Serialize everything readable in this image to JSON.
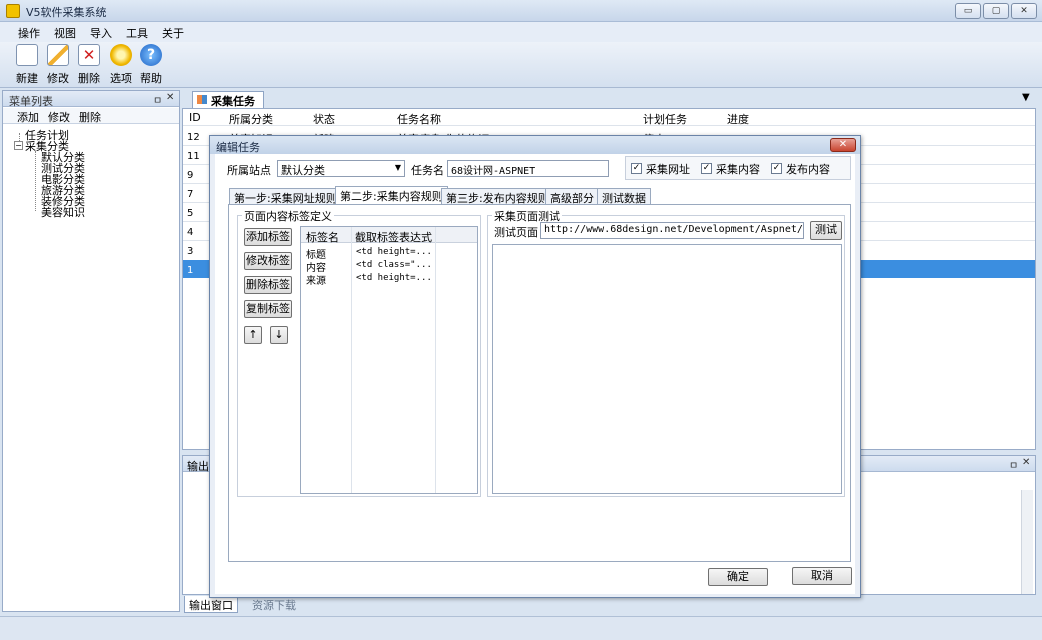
{
  "window": {
    "title": "V5软件采集系统",
    "min": "▭",
    "max": "▢",
    "close": "✕"
  },
  "menu": [
    "操作",
    "视图",
    "导入",
    "工具",
    "关于"
  ],
  "toolbar": [
    {
      "label": "新建",
      "icon": "new-document-icon"
    },
    {
      "label": "修改",
      "icon": "edit-pencil-icon"
    },
    {
      "label": "删除",
      "icon": "delete-x-icon"
    },
    {
      "label": "选项",
      "icon": "gear-options-icon"
    },
    {
      "label": "帮助",
      "icon": "help-question-icon"
    }
  ],
  "left_panel": {
    "title": "菜单列表",
    "pin": "ㅁ",
    "close": "✕",
    "actions": [
      "添加",
      "修改",
      "删除"
    ],
    "tree": {
      "root1": "任务计划",
      "root2": "采集分类",
      "children": [
        "默认分类",
        "测试分类",
        "电影分类",
        "旅游分类",
        "装修分类",
        "美容知识"
      ]
    }
  },
  "doc_tab": "采集任务",
  "task_table": {
    "columns": [
      "ID",
      "所属分类",
      "状态",
      "任务名称",
      "计划任务",
      "进度"
    ],
    "ids": [
      "12",
      "11",
      "9",
      "7",
      "5",
      "4",
      "3",
      "1"
    ],
    "partial_row": {
      "category": "美容知识",
      "status": "新建",
      "name": "美容瘦身-你的修订",
      "plan": "停止"
    }
  },
  "output_panel": {
    "title": "输出窗",
    "pin": "ㅁ",
    "close": "✕"
  },
  "bottom_tabs": [
    "输出窗口",
    "资源下载"
  ],
  "dialog": {
    "title": "编辑任务",
    "site_label": "所属站点",
    "site_value": "默认分类",
    "task_name_label": "任务名",
    "task_name_value": "68设计网-ASPNET",
    "checks": [
      {
        "label": "采集网址",
        "checked": true
      },
      {
        "label": "采集内容",
        "checked": true
      },
      {
        "label": "发布内容",
        "checked": true
      }
    ],
    "tabs": [
      "第一步:采集网址规则",
      "第二步:采集内容规则",
      "第三步:发布内容规则",
      "高级部分",
      "测试数据"
    ],
    "active_tab": 1,
    "tag_group": {
      "title": "页面内容标签定义",
      "buttons": [
        "添加标签",
        "修改标签",
        "删除标签",
        "复制标签"
      ],
      "up": "↑",
      "down": "↓",
      "grid_headers": [
        "标签名",
        "截取标签表达式"
      ],
      "rows": [
        {
          "name": "标题",
          "expr": "<td height=..."
        },
        {
          "name": "内容",
          "expr": "<td class=\"..."
        },
        {
          "name": "来源",
          "expr": "<td height=..."
        }
      ]
    },
    "test_group": {
      "title": "采集页面测试",
      "page_label": "测试页面",
      "url": "http://www.68design.net/Development/Aspnet/Skills-Aspnet",
      "test_button": "测试"
    },
    "ok": "确定",
    "cancel": "取消"
  }
}
